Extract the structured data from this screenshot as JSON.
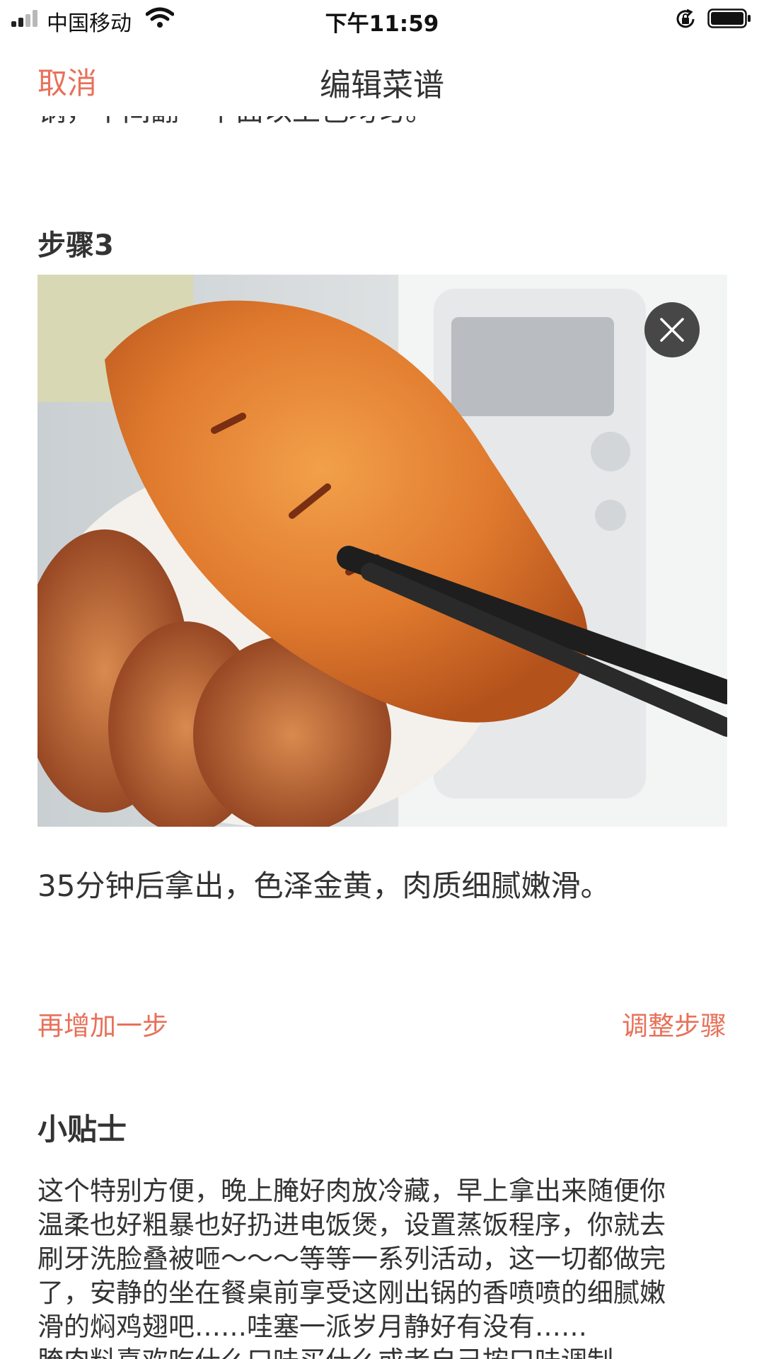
{
  "status_bar": {
    "carrier": "中国移动",
    "time": "下午11:59"
  },
  "nav": {
    "cancel_label": "取消",
    "title": "编辑菜谱"
  },
  "previous_step": {
    "tail_text": "锅，中间翻一下面以上色均匀。"
  },
  "step": {
    "heading": "步骤3",
    "description": "35分钟后拿出，色泽金黄，肉质细腻嫩滑。"
  },
  "actions": {
    "add_step_label": "再增加一步",
    "adjust_steps_label": "调整步骤"
  },
  "tips": {
    "heading": "小贴士",
    "lines": [
      "这个特别方便，晚上腌好肉放冷藏，早上拿出来随便你",
      "温柔也好粗暴也好扔进电饭煲，设置蒸饭程序，你就去",
      "刷牙洗脸叠被咂～～～等等一系列活动，这一切都做完",
      "了，安静的坐在餐桌前享受这刚出锅的香喷喷的细腻嫩",
      "滑的焖鸡翅吧……哇塞一派岁月静好有没有……",
      "腌肉料喜欢吃什么口味买什么或者自己按口味调制"
    ]
  },
  "colors": {
    "accent": "#e8715a",
    "text": "#333333"
  },
  "icons": [
    "signal-icon",
    "wifi-icon",
    "rotation-lock-icon",
    "battery-icon",
    "close-icon"
  ]
}
